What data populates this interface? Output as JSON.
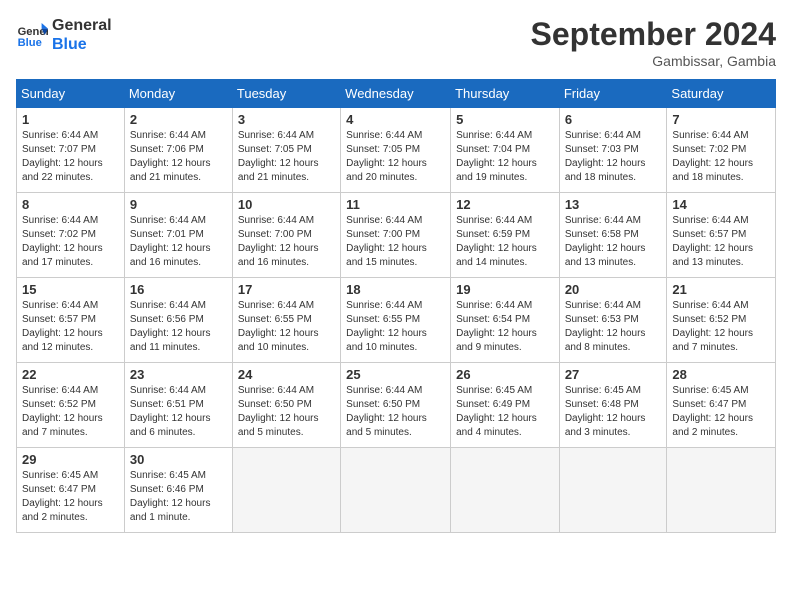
{
  "logo": {
    "line1": "General",
    "line2": "Blue"
  },
  "title": "September 2024",
  "location": "Gambissar, Gambia",
  "days_header": [
    "Sunday",
    "Monday",
    "Tuesday",
    "Wednesday",
    "Thursday",
    "Friday",
    "Saturday"
  ],
  "weeks": [
    [
      {
        "day": "1",
        "sunrise": "6:44 AM",
        "sunset": "7:07 PM",
        "daylight": "12 hours and 22 minutes."
      },
      {
        "day": "2",
        "sunrise": "6:44 AM",
        "sunset": "7:06 PM",
        "daylight": "12 hours and 21 minutes."
      },
      {
        "day": "3",
        "sunrise": "6:44 AM",
        "sunset": "7:05 PM",
        "daylight": "12 hours and 21 minutes."
      },
      {
        "day": "4",
        "sunrise": "6:44 AM",
        "sunset": "7:05 PM",
        "daylight": "12 hours and 20 minutes."
      },
      {
        "day": "5",
        "sunrise": "6:44 AM",
        "sunset": "7:04 PM",
        "daylight": "12 hours and 19 minutes."
      },
      {
        "day": "6",
        "sunrise": "6:44 AM",
        "sunset": "7:03 PM",
        "daylight": "12 hours and 18 minutes."
      },
      {
        "day": "7",
        "sunrise": "6:44 AM",
        "sunset": "7:02 PM",
        "daylight": "12 hours and 18 minutes."
      }
    ],
    [
      {
        "day": "8",
        "sunrise": "6:44 AM",
        "sunset": "7:02 PM",
        "daylight": "12 hours and 17 minutes."
      },
      {
        "day": "9",
        "sunrise": "6:44 AM",
        "sunset": "7:01 PM",
        "daylight": "12 hours and 16 minutes."
      },
      {
        "day": "10",
        "sunrise": "6:44 AM",
        "sunset": "7:00 PM",
        "daylight": "12 hours and 16 minutes."
      },
      {
        "day": "11",
        "sunrise": "6:44 AM",
        "sunset": "7:00 PM",
        "daylight": "12 hours and 15 minutes."
      },
      {
        "day": "12",
        "sunrise": "6:44 AM",
        "sunset": "6:59 PM",
        "daylight": "12 hours and 14 minutes."
      },
      {
        "day": "13",
        "sunrise": "6:44 AM",
        "sunset": "6:58 PM",
        "daylight": "12 hours and 13 minutes."
      },
      {
        "day": "14",
        "sunrise": "6:44 AM",
        "sunset": "6:57 PM",
        "daylight": "12 hours and 13 minutes."
      }
    ],
    [
      {
        "day": "15",
        "sunrise": "6:44 AM",
        "sunset": "6:57 PM",
        "daylight": "12 hours and 12 minutes."
      },
      {
        "day": "16",
        "sunrise": "6:44 AM",
        "sunset": "6:56 PM",
        "daylight": "12 hours and 11 minutes."
      },
      {
        "day": "17",
        "sunrise": "6:44 AM",
        "sunset": "6:55 PM",
        "daylight": "12 hours and 10 minutes."
      },
      {
        "day": "18",
        "sunrise": "6:44 AM",
        "sunset": "6:55 PM",
        "daylight": "12 hours and 10 minutes."
      },
      {
        "day": "19",
        "sunrise": "6:44 AM",
        "sunset": "6:54 PM",
        "daylight": "12 hours and 9 minutes."
      },
      {
        "day": "20",
        "sunrise": "6:44 AM",
        "sunset": "6:53 PM",
        "daylight": "12 hours and 8 minutes."
      },
      {
        "day": "21",
        "sunrise": "6:44 AM",
        "sunset": "6:52 PM",
        "daylight": "12 hours and 7 minutes."
      }
    ],
    [
      {
        "day": "22",
        "sunrise": "6:44 AM",
        "sunset": "6:52 PM",
        "daylight": "12 hours and 7 minutes."
      },
      {
        "day": "23",
        "sunrise": "6:44 AM",
        "sunset": "6:51 PM",
        "daylight": "12 hours and 6 minutes."
      },
      {
        "day": "24",
        "sunrise": "6:44 AM",
        "sunset": "6:50 PM",
        "daylight": "12 hours and 5 minutes."
      },
      {
        "day": "25",
        "sunrise": "6:44 AM",
        "sunset": "6:50 PM",
        "daylight": "12 hours and 5 minutes."
      },
      {
        "day": "26",
        "sunrise": "6:45 AM",
        "sunset": "6:49 PM",
        "daylight": "12 hours and 4 minutes."
      },
      {
        "day": "27",
        "sunrise": "6:45 AM",
        "sunset": "6:48 PM",
        "daylight": "12 hours and 3 minutes."
      },
      {
        "day": "28",
        "sunrise": "6:45 AM",
        "sunset": "6:47 PM",
        "daylight": "12 hours and 2 minutes."
      }
    ],
    [
      {
        "day": "29",
        "sunrise": "6:45 AM",
        "sunset": "6:47 PM",
        "daylight": "12 hours and 2 minutes."
      },
      {
        "day": "30",
        "sunrise": "6:45 AM",
        "sunset": "6:46 PM",
        "daylight": "12 hours and 1 minute."
      },
      null,
      null,
      null,
      null,
      null
    ]
  ]
}
